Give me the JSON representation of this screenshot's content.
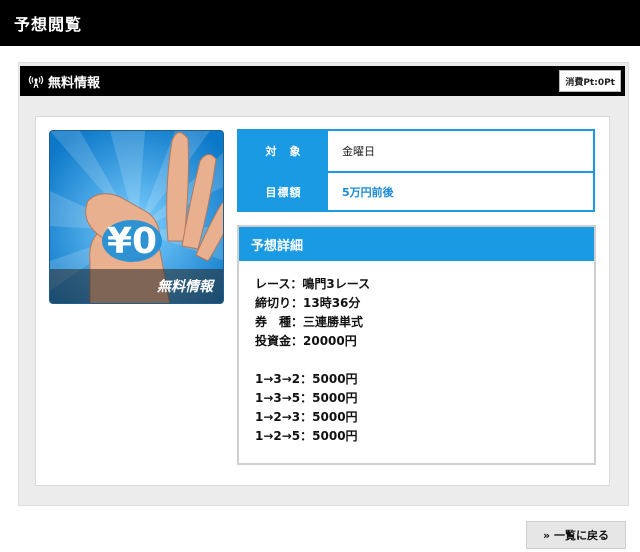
{
  "header": {
    "title": "予想閲覧"
  },
  "section": {
    "title": "無料情報",
    "points_badge": "消費Pt:0Pt"
  },
  "promo_image": {
    "price_text": "¥0",
    "caption": "無料情報"
  },
  "info": {
    "rows": [
      {
        "label": "対　象",
        "value": "金曜日"
      },
      {
        "label": "目標額",
        "value": "5万円前後"
      }
    ]
  },
  "detail": {
    "title": "予想詳細",
    "lines": [
      "レース：鳴門3レース",
      "締切り：13時36分",
      "券　種：三連勝単式",
      "投資金：20000円"
    ],
    "bets": [
      "1→3→2：5000円",
      "1→3→5：5000円",
      "1→2→3：5000円",
      "1→2→5：5000円"
    ]
  },
  "footer": {
    "back_label": "一覧に戻る"
  },
  "colors": {
    "accent": "#1a9ae3",
    "header_bg": "#000000"
  }
}
